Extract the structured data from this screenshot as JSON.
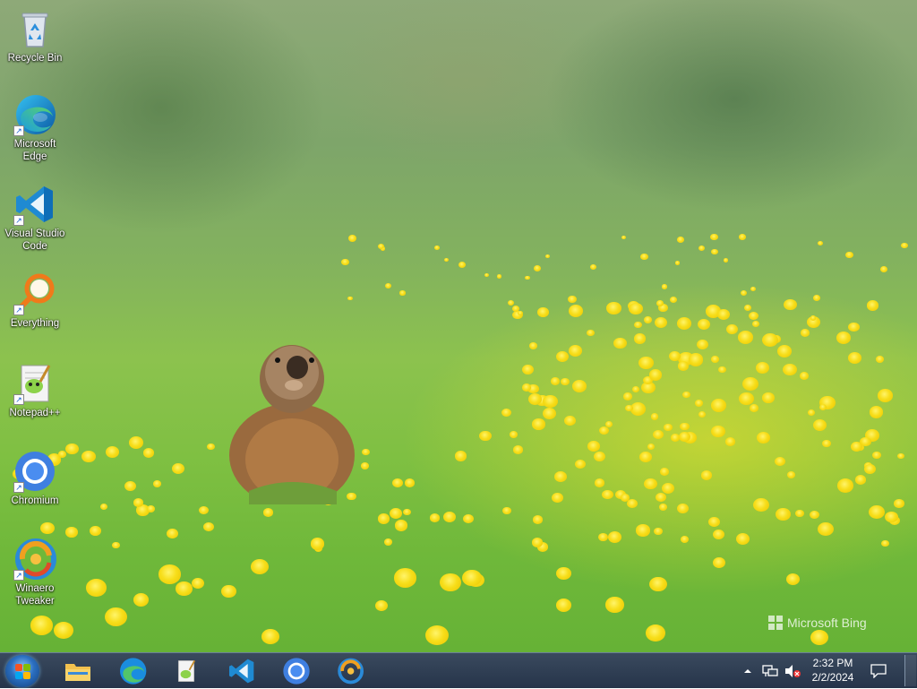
{
  "desktop": {
    "icons": [
      {
        "label": "Recycle Bin",
        "icon": "recycle-bin-icon"
      },
      {
        "label": "Microsoft Edge",
        "icon": "edge-icon"
      },
      {
        "label": "Visual Studio Code",
        "icon": "vscode-icon"
      },
      {
        "label": "Everything",
        "icon": "everything-search-icon"
      },
      {
        "label": "Notepad++",
        "icon": "notepadpp-icon"
      },
      {
        "label": "Chromium",
        "icon": "chromium-icon"
      },
      {
        "label": "Winaero Tweaker",
        "icon": "winaero-tweaker-icon"
      }
    ],
    "watermark": "Microsoft Bing"
  },
  "taskbar": {
    "apps": [
      "file-explorer-icon",
      "edge-icon",
      "notepadpp-icon",
      "vscode-icon",
      "chromium-icon",
      "winaero-tweaker-icon"
    ],
    "clock": {
      "time": "2:32 PM",
      "date": "2/2/2024"
    },
    "tray": [
      "show-hidden-icons-chevron",
      "network-icon",
      "volume-muted-icon",
      "action-center-icon"
    ]
  },
  "colors": {
    "taskbar": "#26344a",
    "accent": "#2b6fc0"
  }
}
